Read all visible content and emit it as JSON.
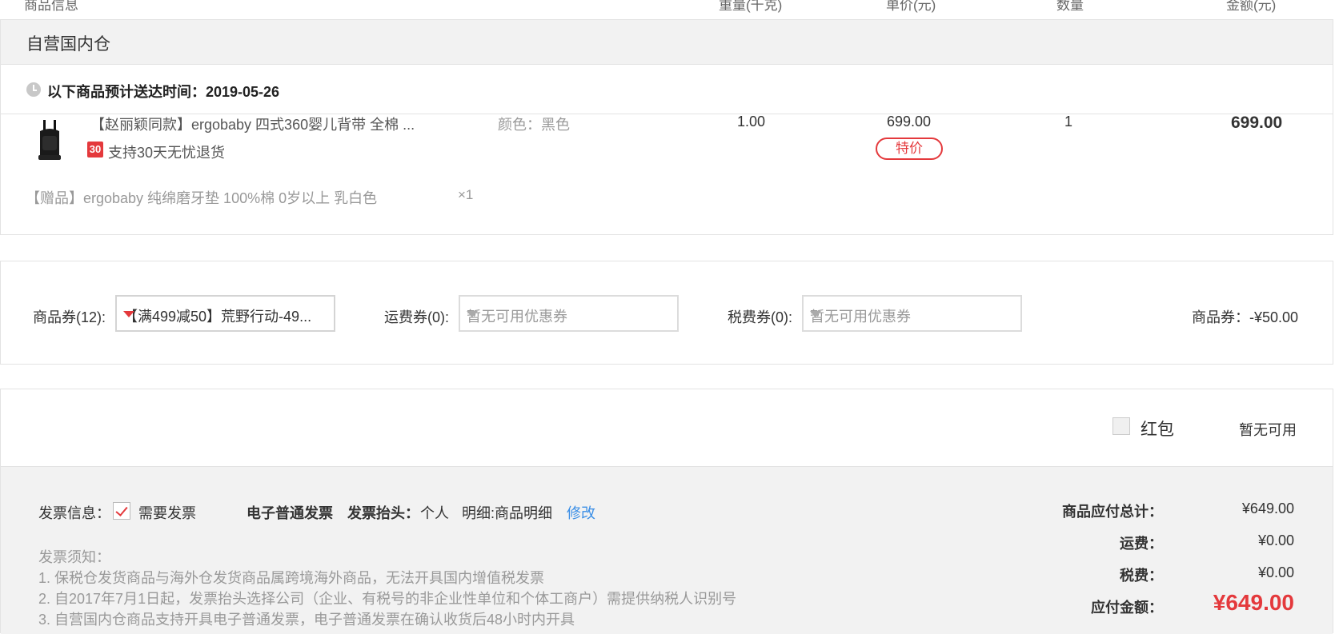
{
  "header": {
    "col_product": "商品信息",
    "col_weight": "重量(千克)",
    "col_unit_price": "单价(元)",
    "col_qty": "数量",
    "col_amount": "金额(元)"
  },
  "warehouse": {
    "title": "自营国内仓",
    "delivery_text": "以下商品预计送达时间：2019-05-26"
  },
  "item": {
    "name": "【赵丽颖同款】ergobaby 四式360婴儿背带 全棉 ...",
    "refund_badge": "30",
    "refund_text": "支持30天无忧退货",
    "color": "颜色：黑色",
    "weight": "1.00",
    "unit_price": "699.00",
    "price_tag": "特价",
    "qty": "1",
    "amount": "699.00"
  },
  "gift": {
    "name": "【赠品】ergobaby 纯绵磨牙垫 100%棉 0岁以上  乳白色",
    "qty": "×1"
  },
  "coupons": {
    "goods_label": "商品券(12):",
    "goods_selected": "【满499减50】荒野行动-49...",
    "shipping_label": "运费券(0):",
    "shipping_placeholder": "暂无可用优惠券",
    "tax_label": "税费券(0):",
    "tax_placeholder": "暂无可用优惠券",
    "discount_summary": "商品券：-¥50.00"
  },
  "red_packet": {
    "label": "红包",
    "status": "暂无可用"
  },
  "invoice": {
    "label": "发票信息：",
    "need_invoice": "需要发票",
    "type": "电子普通发票",
    "title_label": "发票抬头：",
    "title_value": "个人",
    "detail": "明细:商品明细",
    "edit_link": "修改",
    "notes_title": "发票须知：",
    "notes": [
      "1. 保税仓发货商品与海外仓发货商品属跨境海外商品，无法开具国内增值税发票",
      "2. 自2017年7月1日起，发票抬头选择公司（企业、有税号的非企业性单位和个体工商户）需提供纳税人识别号",
      "3. 自营国内仓商品支持开具电子普通发票，电子普通发票在确认收货后48小时内开具"
    ]
  },
  "summary": {
    "goods_total_label": "商品应付总计：",
    "goods_total": "¥649.00",
    "shipping_label": "运费：",
    "shipping": "¥0.00",
    "tax_label": "税费：",
    "tax": "¥0.00",
    "payable_label": "应付金额：",
    "payable": "¥649.00"
  },
  "colors": {
    "accent_red": "#e4393c",
    "link_blue": "#3a8ee6",
    "panel_gray": "#f2f2f2"
  }
}
